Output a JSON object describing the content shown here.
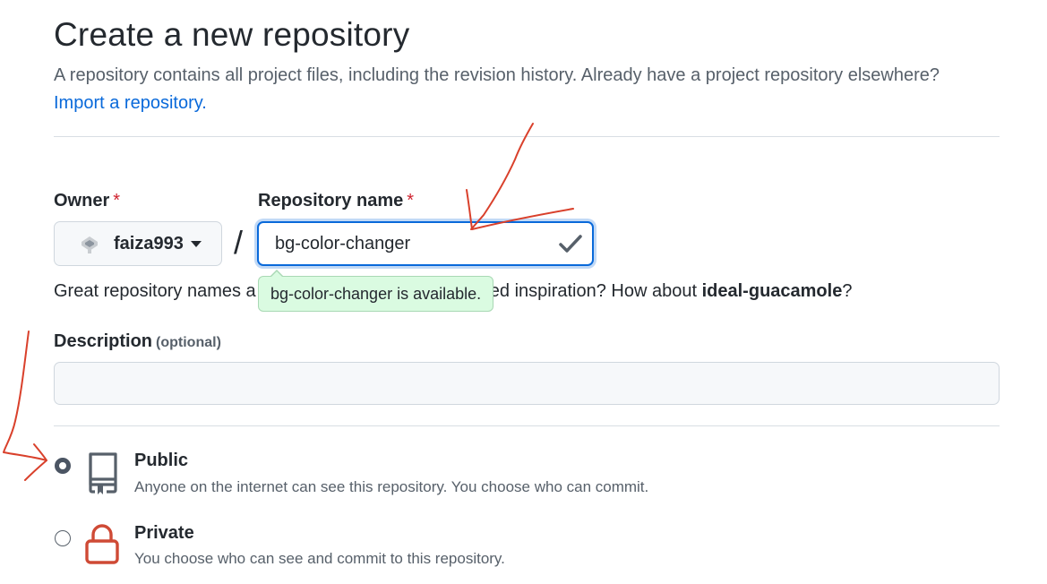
{
  "header": {
    "title": "Create a new repository",
    "subtitle": "A repository contains all project files, including the revision history. Already have a project repository elsewhere?",
    "import_link": "Import a repository."
  },
  "owner": {
    "label": "Owner",
    "required_mark": "*",
    "selected": "faiza993",
    "icon": "avatar-icon"
  },
  "separator": "/",
  "repo_name": {
    "label": "Repository name",
    "required_mark": "*",
    "value": "bg-color-changer",
    "status_icon": "check-icon"
  },
  "availability_tooltip": "bg-color-changer is available.",
  "name_hint": {
    "prefix": "Great repository names a",
    "middle": "eed inspiration? How about ",
    "suggestion": "ideal-guacamole",
    "suffix": "?"
  },
  "description": {
    "label": "Description",
    "optional": "(optional)",
    "value": ""
  },
  "visibility": {
    "options": [
      {
        "title": "Public",
        "description": "Anyone on the internet can see this repository. You choose who can commit.",
        "checked": true,
        "icon": "repo-icon"
      },
      {
        "title": "Private",
        "description": "You choose who can see and commit to this repository.",
        "checked": false,
        "icon": "lock-icon"
      }
    ]
  },
  "colors": {
    "accent": "#0969da",
    "success_bg": "#dafbe1",
    "annotation": "#d9402b",
    "lock": "#cf4a35",
    "check": "#57606a"
  }
}
